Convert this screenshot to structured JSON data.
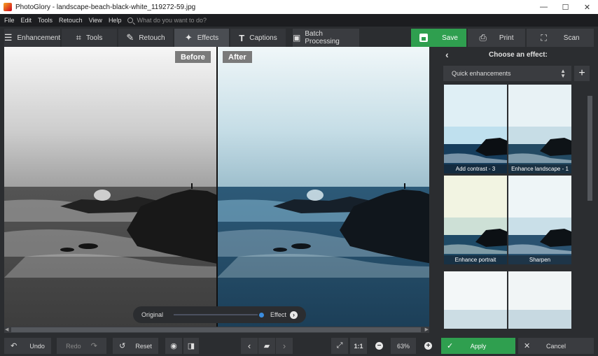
{
  "window": {
    "title": "PhotoGlory - landscape-beach-black-white_119272-59.jpg",
    "minimize": "—",
    "maximize": "☐",
    "close": "✕"
  },
  "menu": {
    "items": [
      "File",
      "Edit",
      "Tools",
      "Retouch",
      "View",
      "Help"
    ],
    "search_placeholder": "What do you want to do?"
  },
  "toolbar": {
    "tabs": [
      {
        "label": "Enhancement",
        "icon": "sliders-icon"
      },
      {
        "label": "Tools",
        "icon": "crop-icon"
      },
      {
        "label": "Retouch",
        "icon": "brush-icon"
      },
      {
        "label": "Effects",
        "icon": "magic-wand-icon"
      },
      {
        "label": "Captions",
        "icon": "text-icon"
      }
    ],
    "active_tab": "Effects",
    "batch_label": "Batch Processing",
    "save_label": "Save",
    "print_label": "Print",
    "scan_label": "Scan",
    "accent_save": "#2f9f4f"
  },
  "canvas": {
    "before_label": "Before",
    "after_label": "After",
    "slider_left": "Original",
    "slider_right": "Effect"
  },
  "panel": {
    "title": "Choose an effect:",
    "dropdown_value": "Quick enhancements",
    "add_label": "+",
    "effects": [
      {
        "label": "Add contrast - 3"
      },
      {
        "label": "Enhance landscape - 1"
      },
      {
        "label": "Enhance portrait"
      },
      {
        "label": "Sharpen"
      },
      {
        "label": ""
      },
      {
        "label": ""
      }
    ]
  },
  "bottom": {
    "undo_label": "Undo",
    "redo_label": "Redo",
    "reset_label": "Reset",
    "ratio_label": "1:1",
    "zoom_value": "63%",
    "apply_label": "Apply",
    "cancel_label": "Cancel",
    "accent_apply": "#2f9f4f"
  }
}
